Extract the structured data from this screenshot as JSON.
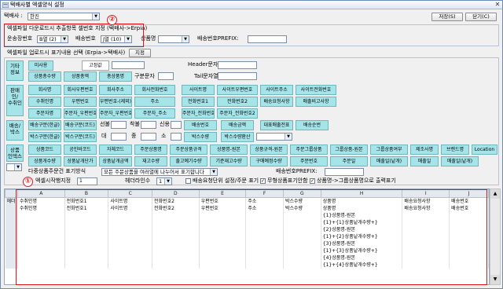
{
  "window": {
    "title": "택배사별 엑셀양식 설정",
    "close_glyph": "✕"
  },
  "top": {
    "courier_label": "택배사 :",
    "courier_value": "한진",
    "save_label": "저장(S)",
    "close_label": "닫기(C)"
  },
  "download": {
    "heading": "엑셀파일 다운로드시 추출항목 셀번호 지정 (택배사->Erpia)",
    "tracking_label": "운송장번호",
    "tracking_value": "B열 (2)",
    "delivery_label": "배송번호",
    "delivery_value": "J열 (10)",
    "product_label": "상품명",
    "prefix_label": "배송번호PREFIX:"
  },
  "upload": {
    "heading": "엑셀파일 업로드시 표기내용 선택 (Erpia->택배사)",
    "apply_label": "지정"
  },
  "categories": {
    "basic": "기타\n정보",
    "buyer": "판매인/\n수취인",
    "delivery": "배송/\n박스",
    "product": "상품\n인덱스"
  },
  "buttons": {
    "none": "미사용",
    "fixed": "고정값",
    "header": "Header문자열",
    "tail": "Tail문자열",
    "qty": "상품총수량",
    "price": "상품총액",
    "count": "총상품명",
    "sep": "구분문자",
    "sender": "회사명",
    "sender_zip": "회사우편번호",
    "sender_addr": "회사주소",
    "sender_tel": "회사전화번호",
    "site": "사이트명",
    "site_zip": "사이트우편번호",
    "site_addr": "사이트주소",
    "site_tel": "사이트전화번호",
    "recv": "수취인명",
    "recv_zip": "우편번호",
    "recv_zip2": "우편번호-(제외)",
    "recv_addr": "주소",
    "recv_tel1": "전화번호1",
    "recv_tel2": "전화번호2",
    "req": "배송요청사항",
    "sale_memo": "매출비고사항",
    "orderer": "주문자명",
    "ord_zip": "주문자_우편번호",
    "ord_zip2": "주문자_우편번호(제외)",
    "ord_addr": "주문자_주소",
    "ord_tel1": "주문자_전화번호1",
    "ord_tel2": "주문자_전화번호2",
    "deliv_type": "배송구분(한글)",
    "deliv_code": "배송구분(코드)",
    "pay": "선불",
    "cod": "착불",
    "credit": "신용",
    "deliv_no": "배송번호",
    "deliv_amt": "배송금액",
    "rep_slip": "대표매출전표",
    "deliv_order": "배송순번",
    "box_type": "박스구분(한글)",
    "box_code": "박스구분(코드)",
    "big": "대",
    "mid": "중",
    "small": "소",
    "box_qty": "박스수량",
    "box_calc": "박스수량환산",
    "p_code": "상품코드",
    "p_barcode": "공인바코드",
    "p_code2": "자체코드",
    "p_name": "주문상품명",
    "p_spec": "주문상품규격",
    "p_name_orig": "상품명-원본",
    "p_spec_orig": "상품규격-원본",
    "p_model": "주문그룹상품",
    "p_group": "그룹상품-원본",
    "p_group_yn": "그룹상품여부",
    "maker": "제조사명",
    "brand": "브랜드명",
    "location": "Location",
    "p_qty": "상품개수량",
    "p_unit": "상품낱개단가",
    "p_sum": "상품낱개금액",
    "stock": "재고수량",
    "out_qty": "출고예기수량",
    "base_stock": "기준재고수량",
    "order_qty": "구매예정수량",
    "ord_price": "주문번호",
    "ord_index": "주문일",
    "sale_x": "매출일(낱개)",
    "sale_date": "매출일",
    "sale_x2": "매출일(낱개)"
  },
  "options": {
    "multi_label": "다중상품주문건 표기방식",
    "multi_value": "모든 주문상품을 여러열에 나누어서 표기합니다",
    "prefix_label": "배송번호PREFIX:",
    "start_label": "엑셀시작행지정",
    "start_value": "1",
    "header_label": "헤더라인수",
    "header_value": "1",
    "chk1": "배송요청단위 설정/주문 표기",
    "chk2": "무형상품표기안함",
    "chk3": "상품명->그룹상품명으로 출력표기"
  },
  "grid": {
    "row_header": "헤더",
    "columns": [
      "A",
      "B",
      "C",
      "D",
      "E",
      "F",
      "G",
      "H",
      "I",
      "J"
    ],
    "rows": [
      [
        "수취인명",
        "전화번호1",
        "사이트명",
        "전화번호2",
        "우편번호",
        "주소",
        "박스수량",
        "상품명",
        "배송요청사항",
        "배송번호"
      ],
      [
        "수취인명",
        "전화번호1",
        "사이트명",
        "전화번호2",
        "우편번호",
        "주소",
        "박스수량",
        "상품명",
        "배송요청사항",
        "배송번호"
      ],
      [
        "",
        "",
        "",
        "",
        "",
        "",
        "",
        "{1}상품명-원본",
        "",
        ""
      ],
      [
        "",
        "",
        "",
        "",
        "",
        "",
        "",
        "{1}+{1}상품낱개수량+}",
        "",
        ""
      ],
      [
        "",
        "",
        "",
        "",
        "",
        "",
        "",
        "{2}상품명-원본",
        "",
        ""
      ],
      [
        "",
        "",
        "",
        "",
        "",
        "",
        "",
        "{1}+{2}상품낱개수량+}",
        "",
        ""
      ],
      [
        "",
        "",
        "",
        "",
        "",
        "",
        "",
        "{3}상품명-원본",
        "",
        ""
      ],
      [
        "",
        "",
        "",
        "",
        "",
        "",
        "",
        "{1}+{3}상품낱개수량+}",
        "",
        ""
      ],
      [
        "",
        "",
        "",
        "",
        "",
        "",
        "",
        "{4}상품명-원본",
        "",
        ""
      ],
      [
        "",
        "",
        "",
        "",
        "",
        "",
        "",
        "{1}+{4}상품낱개수량+}",
        "",
        ""
      ]
    ]
  },
  "annotations": {
    "one": "①",
    "two": "②"
  },
  "colors": {
    "accent_button": "#a5e5ea",
    "annotation_red": "#e0141c"
  }
}
